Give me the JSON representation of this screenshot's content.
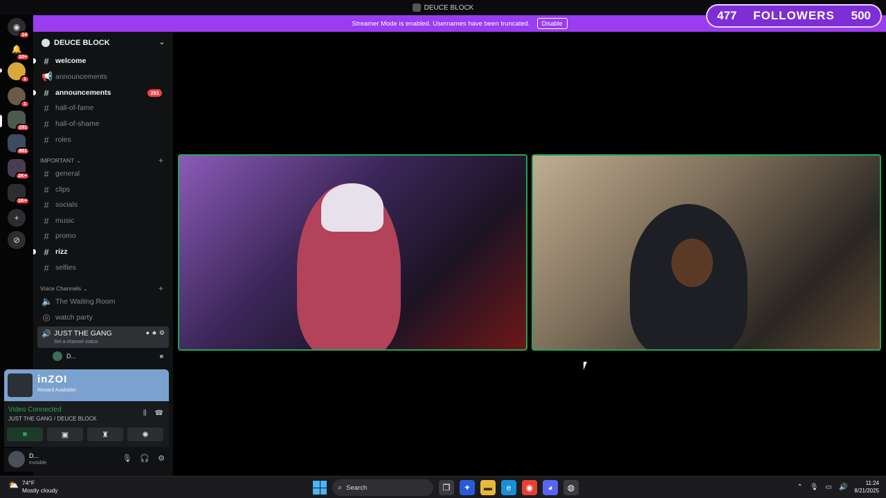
{
  "window": {
    "title": "DEUCE BLOCK"
  },
  "banner": {
    "text": "Streamer Mode is enabled. Usernames have been truncated.",
    "disable_label": "Disable"
  },
  "followers": {
    "current": "477",
    "label": "FOLLOWERS",
    "goal": "500"
  },
  "server_rail": {
    "home_badge": "14",
    "items": [
      {
        "name": "notifications",
        "badge": "10+"
      },
      {
        "name": "server-a",
        "badge": "1"
      },
      {
        "name": "server-b",
        "badge": "1"
      },
      {
        "name": "server-c",
        "badge": "291"
      },
      {
        "name": "server-d",
        "badge": "881"
      },
      {
        "name": "server-e",
        "badge": "2K+"
      },
      {
        "name": "server-f",
        "badge": "1K+"
      }
    ]
  },
  "server": {
    "name": "DEUCE BLOCK"
  },
  "channels_top": [
    {
      "name": "welcome",
      "unread": true
    },
    {
      "name": "announcements",
      "unread": false,
      "icon": "megaphone"
    },
    {
      "name": "announcements",
      "unread": true,
      "badge": "291"
    },
    {
      "name": "hall-of-fame",
      "unread": false
    },
    {
      "name": "hall-of-shame",
      "unread": false
    },
    {
      "name": "roles",
      "unread": false
    }
  ],
  "category_important": "IMPORTANT",
  "channels_important": [
    {
      "name": "general",
      "unread": false
    },
    {
      "name": "clips",
      "unread": false
    },
    {
      "name": "socials",
      "unread": false
    },
    {
      "name": "music",
      "unread": false
    },
    {
      "name": "promo",
      "unread": false
    },
    {
      "name": "rizz",
      "unread": true
    },
    {
      "name": "selfies",
      "unread": false
    }
  ],
  "category_voice": "Voice Channels",
  "voice_channels": [
    {
      "name": "The Waiting Room"
    },
    {
      "name": "watch party"
    }
  ],
  "active_voice": {
    "name": "JUST THE GANG",
    "status": "Set a channel status"
  },
  "voice_user": {
    "name": "D..."
  },
  "promo": {
    "title": "inZOI",
    "subtitle": "Reward Available!"
  },
  "connection": {
    "status": "Video Connected",
    "path": "JUST THE GANG / DEUCE BLOCK"
  },
  "user": {
    "name": "D...",
    "status": "Invisible"
  },
  "taskbar": {
    "weather_temp": "74°F",
    "weather_desc": "Mostly cloudy",
    "search_label": "Search",
    "time": "11:24",
    "date": "8/21/2025"
  },
  "colors": {
    "streamer_banner": "#9b3cf0",
    "followers_bg": "#7d2ed6",
    "speaking_border": "#23a55a",
    "badge": "#f23f43"
  }
}
